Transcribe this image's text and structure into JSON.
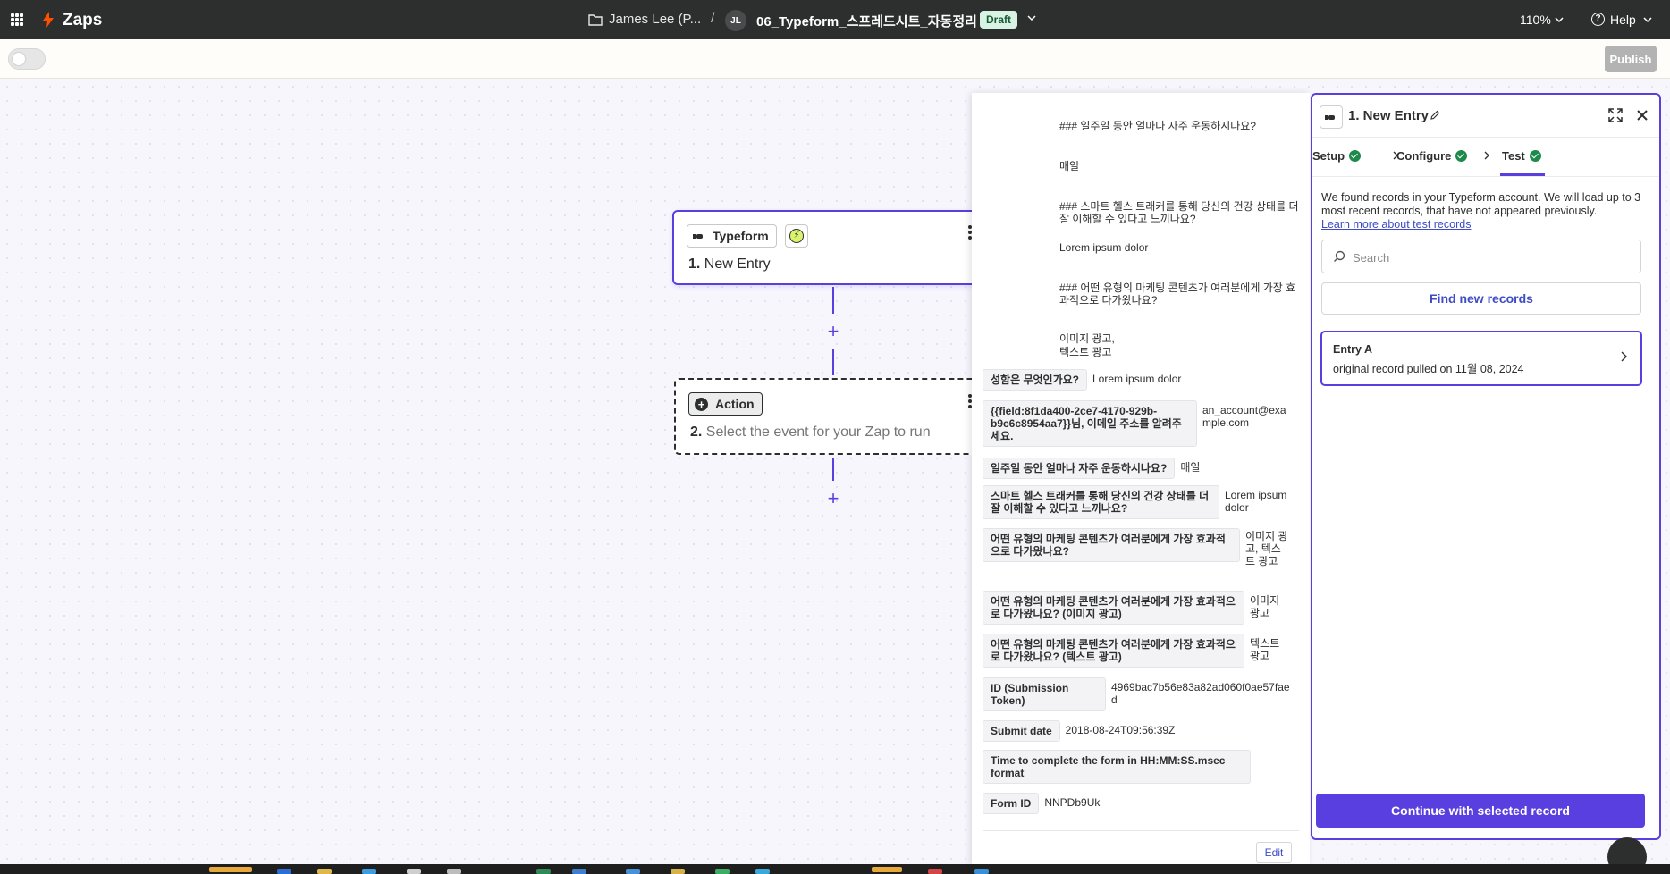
{
  "header": {
    "app_name": "Zaps",
    "folder": "James Lee (P...",
    "separator": "/",
    "avatar_initials": "JL",
    "zap_title": "06_Typeform_스프레드시트_자동정리",
    "status_badge": "Draft",
    "zoom": "110%",
    "help_label": "Help"
  },
  "toolbar": {
    "publish_label": "Publish"
  },
  "canvas": {
    "step1": {
      "app_label": "Typeform",
      "number": "1.",
      "title": "New Entry"
    },
    "step2": {
      "app_label": "Action",
      "number": "2.",
      "title": "Select the event for your Zap to run"
    }
  },
  "data_panel": {
    "raw_lines": [
      "### 일주일 동안 얼마나 자주 운동하시나요?",
      "매일",
      "### 스마트 헬스 트래커를 통해 당신의 건강 상태를 더 잘 이해할 수 있다고 느끼나요?",
      "Lorem ipsum dolor",
      "### 어떤 유형의 마케팅 콘텐츠가 여러분에게 가장 효과적으로 다가왔나요?",
      "이미지 광고,",
      "텍스트 광고"
    ],
    "fields": [
      {
        "key": "성함은 무엇인가요?",
        "value": "Lorem ipsum dolor"
      },
      {
        "key": "{{field:8f1da400-2ce7-4170-929b-b9c6c8954aa7}}님, 이메일 주소를 알려주세요.",
        "value": "an_account@example.com"
      },
      {
        "key": "일주일 동안 얼마나 자주 운동하시나요?",
        "value": "매일"
      },
      {
        "key": "스마트 헬스 트래커를 통해 당신의 건강 상태를 더 잘 이해할 수 있다고 느끼나요?",
        "value": "Lorem ipsum dolor"
      },
      {
        "key": "어떤 유형의 마케팅 콘텐츠가 여러분에게 가장 효과적으로 다가왔나요?",
        "value": "이미지 광고, 텍스트 광고"
      },
      {
        "key": "어떤 유형의 마케팅 콘텐츠가 여러분에게 가장 효과적으로 다가왔나요? (이미지 광고)",
        "value": "이미지 광고"
      },
      {
        "key": "어떤 유형의 마케팅 콘텐츠가 여러분에게 가장 효과적으로 다가왔나요? (텍스트 광고)",
        "value": "텍스트 광고"
      },
      {
        "key": "ID (Submission Token)",
        "value": "4969bac7b56e83a82ad060f0ae57faed"
      },
      {
        "key": "Submit date",
        "value": "2018-08-24T09:56:39Z"
      },
      {
        "key": "Time to complete the form in HH:MM:SS.msec format",
        "value": ""
      },
      {
        "key": "Form ID",
        "value": "NNPDb9Uk"
      }
    ],
    "edit_label": "Edit"
  },
  "side_panel": {
    "title": "1. New Entry",
    "tabs": [
      {
        "label": "Setup",
        "complete": true
      },
      {
        "label": "Configure",
        "complete": true
      },
      {
        "label": "Test",
        "complete": true,
        "active": true
      }
    ],
    "description": "We found records in your Typeform account. We will load up to 3 most recent records, that have not appeared previously.",
    "learn_link": "Learn more about test records",
    "search_placeholder": "Search",
    "find_button": "Find new records",
    "record": {
      "title": "Entry A",
      "subtitle": "original record pulled on 11월 08, 2024"
    },
    "continue_button": "Continue with selected record"
  },
  "colors": {
    "brand_orange": "#ff4f00",
    "accent_purple": "#5a3fe0",
    "link_blue": "#3d4bc6",
    "success_green": "#1d8a4c",
    "topbar": "#2d2e2e"
  },
  "icons": [
    "apps-grid-icon",
    "zapier-bolt-icon",
    "folder-icon",
    "chevron-down-icon",
    "help-icon",
    "typeform-icon",
    "trigger-bolt-icon",
    "pencil-icon",
    "expand-icon",
    "close-icon",
    "check-icon",
    "chevron-right-icon",
    "search-icon",
    "support-icon"
  ]
}
